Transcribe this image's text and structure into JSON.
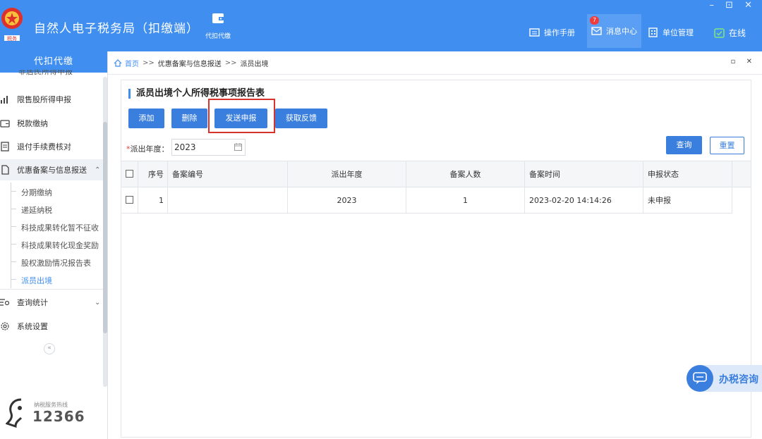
{
  "app": {
    "title": "自然人电子税务局（扣缴端）",
    "module_tab": "代扣代缴",
    "window_controls": "– ⊡ ✕",
    "brand_color": "#3f8ef0",
    "accent_button": "#3b7fde",
    "highlight_red": "#d9322c"
  },
  "toolbar": {
    "manual": "操作手册",
    "messages": "消息中心",
    "messages_badge": "7",
    "org_mgmt": "单位管理",
    "online": "在线"
  },
  "sidebar": {
    "header": "代扣代缴",
    "cut_item": "非居民所得申报",
    "items": [
      {
        "label": "限售股所得申报",
        "icon": "chart-icon"
      },
      {
        "label": "税款缴纳",
        "icon": "wallet-icon"
      },
      {
        "label": "退付手续费核对",
        "icon": "receipt-icon"
      },
      {
        "label": "优惠备案与信息报送",
        "icon": "doc-icon",
        "expanded": true
      }
    ],
    "sub_items": [
      "分期缴纳",
      "递延纳税",
      "科技成果转化暂不征收",
      "科技成果转化现金奖励",
      "股权激励情况报告表",
      "派员出境"
    ],
    "active_sub": "派员出境",
    "bottom_items": [
      {
        "label": "查询统计",
        "icon": "search-list-icon"
      },
      {
        "label": "系统设置",
        "icon": "gear-icon"
      }
    ],
    "collapse": "«",
    "hotline_label": "纳税服务热线",
    "hotline_number": "12366"
  },
  "breadcrumb": {
    "home": "首页",
    "sep": ">>",
    "level1": "优惠备案与信息报送",
    "current": "派员出境",
    "controls": "▫ ✕"
  },
  "page": {
    "title": "派员出境个人所得税事项报告表",
    "buttons": {
      "add": "添加",
      "delete": "删除",
      "send": "发送申报",
      "feedback": "获取反馈"
    },
    "filter": {
      "req": "*",
      "label": "派出年度：",
      "value": "2023"
    },
    "query": "查询",
    "reset": "重置"
  },
  "table": {
    "columns": [
      "序号",
      "备案编号",
      "派出年度",
      "备案人数",
      "备案时间",
      "申报状态"
    ],
    "rows": [
      {
        "seq": "1",
        "record_no": "",
        "year": "2023",
        "count": "1",
        "time": "2023-02-20 14:14:26",
        "status": "未申报"
      }
    ]
  },
  "float_consult": "办税咨询"
}
